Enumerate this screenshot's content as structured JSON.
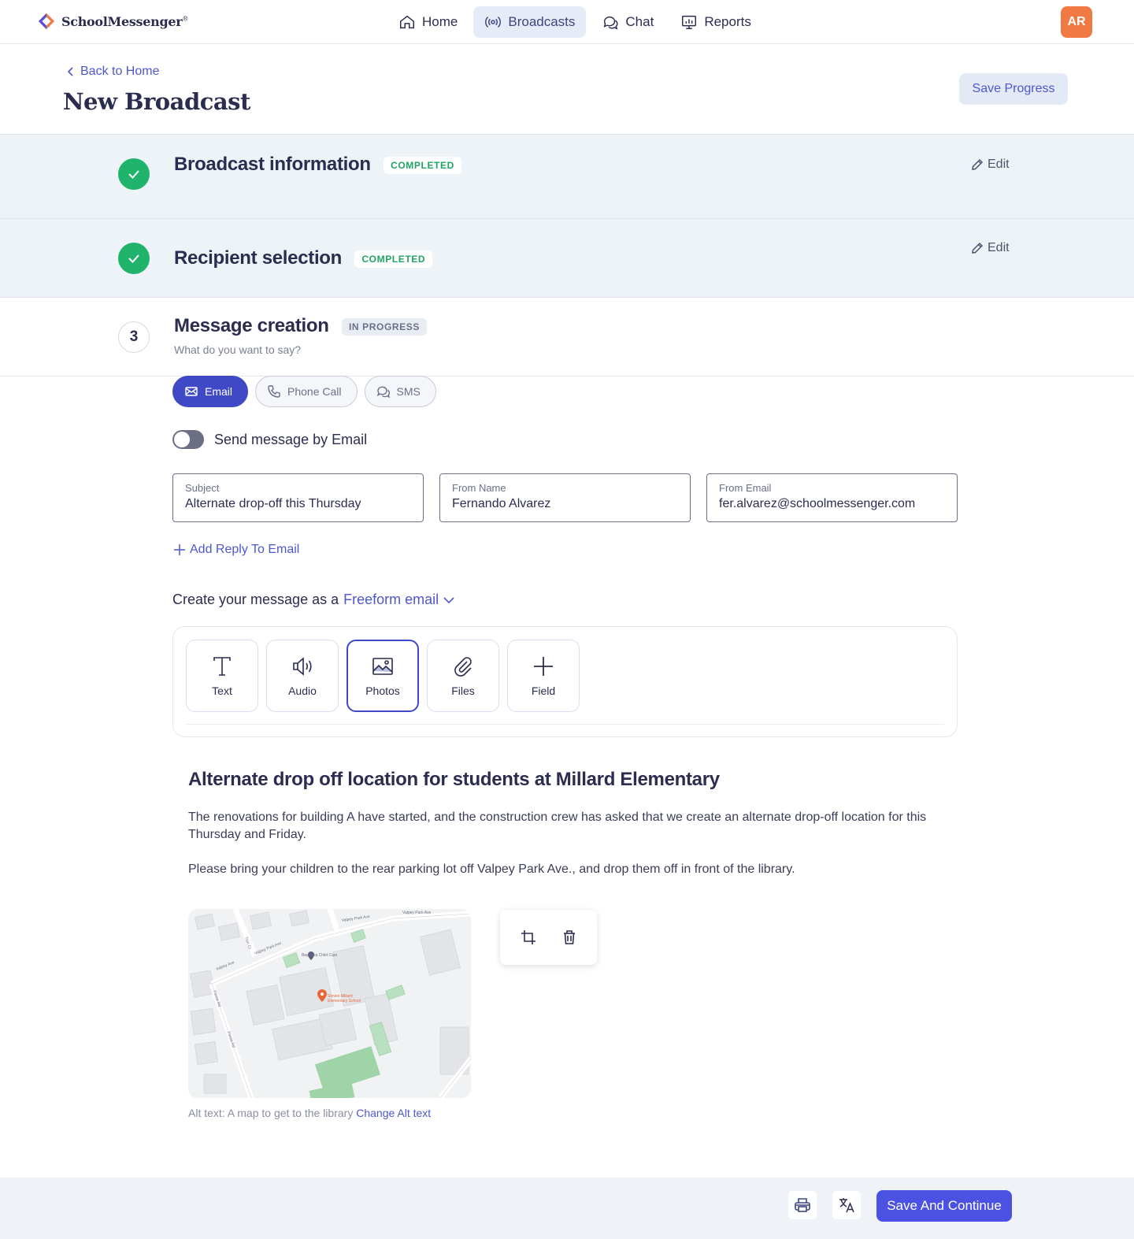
{
  "app": {
    "logo_text": "SchoolMessenger",
    "logo_mark": "®"
  },
  "nav": {
    "items": [
      {
        "label": "Home",
        "icon": "home-icon"
      },
      {
        "label": "Broadcasts",
        "icon": "broadcast-icon",
        "active": true
      },
      {
        "label": "Chat",
        "icon": "chat-icon"
      },
      {
        "label": "Reports",
        "icon": "reports-icon"
      }
    ],
    "avatar_initials": "AR",
    "avatar_color": "#f07a44"
  },
  "header": {
    "back_label": "Back to Home",
    "title": "New Broadcast",
    "save_progress": "Save Progress"
  },
  "steps": [
    {
      "title": "Broadcast information",
      "status": "COMPLETED",
      "edit": "Edit"
    },
    {
      "title": "Recipient selection",
      "status": "COMPLETED",
      "edit": "Edit"
    },
    {
      "number": "3",
      "title": "Message creation",
      "status": "IN PROGRESS",
      "subtitle": "What do you want to say?"
    }
  ],
  "channels": [
    {
      "label": "Email",
      "icon": "mail-icon",
      "active": true
    },
    {
      "label": "Phone Call",
      "icon": "phone-icon"
    },
    {
      "label": "SMS",
      "icon": "sms-icon"
    }
  ],
  "toggle": {
    "label": "Send message by Email",
    "on": false
  },
  "fields": {
    "subject": {
      "label": "Subject",
      "value": "Alternate drop-off this Thursday"
    },
    "from_name": {
      "label": "From Name",
      "value": "Fernando Alvarez"
    },
    "from_email": {
      "label": "From Email",
      "value": "fer.alvarez@schoolmessenger.com"
    }
  },
  "add_reply": "Add Reply To Email",
  "create": {
    "prefix": "Create your message as a",
    "type": "Freeform email"
  },
  "tools": [
    {
      "label": "Text",
      "icon": "text-icon"
    },
    {
      "label": "Audio",
      "icon": "audio-icon"
    },
    {
      "label": "Photos",
      "icon": "photo-icon",
      "active": true
    },
    {
      "label": "Files",
      "icon": "paperclip-icon"
    },
    {
      "label": "Field",
      "icon": "plus-icon"
    }
  ],
  "message": {
    "heading": "Alternate drop off location for students at Millard Elementary",
    "p1": "The renovations for building A have started, and the construction crew has asked that we create an alternate drop-off location for this Thursday and Friday.",
    "p2": "Please bring your children to the rear parking lot off Valpey Park Ave., and drop them off in front of the library."
  },
  "map": {
    "labels": {
      "street_top": "Valpey Park Ave",
      "street_top2": "Valpey Park Ave",
      "street_mid": "Valpey Park Ave",
      "street_left": "Valpey Ave",
      "street_vert1": "Fiesta Rd",
      "street_vert2": "Fiesta Rd",
      "street_ct": "Tion Ct",
      "poi_childcare": "Bay Area Child Care",
      "poi_school_1": "Steven Millard",
      "poi_school_2": "Elementary School"
    }
  },
  "alt": {
    "prefix": "Alt text: A map to get to the library",
    "change": "Change Alt text"
  },
  "footer": {
    "save_continue": "Save And Continue"
  },
  "colors": {
    "accent": "#4b52e3",
    "success": "#1fb36b",
    "completed_bg": "#eef3f8"
  }
}
